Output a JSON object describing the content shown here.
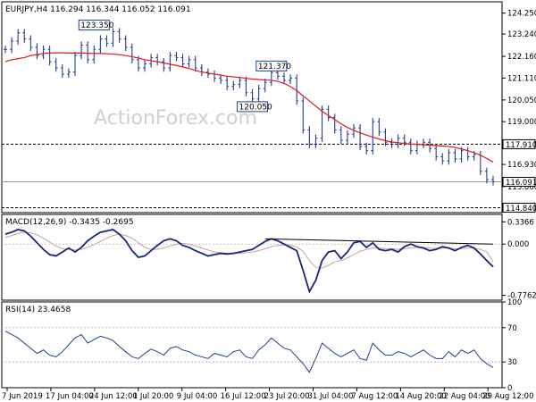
{
  "watermark": "ActionForex.com",
  "chart_data": [
    {
      "type": "candlestick",
      "title": "EURJPY,H4 116.294 116.344 116.052 116.091",
      "ylim": [
        114.6,
        124.8
      ],
      "y_ticks": [
        "124.250",
        "123.240",
        "122.160",
        "121.110",
        "120.050",
        "119.000",
        "117.910",
        "116.930",
        "115.860"
      ],
      "price_line": {
        "value": 116.091,
        "label": "116.091"
      },
      "levels": [
        {
          "value": 117.91,
          "label": "117.910",
          "style": "dashed"
        },
        {
          "value": 114.84,
          "label": "114.840",
          "style": "dashed"
        }
      ],
      "annotations": [
        {
          "text": "123.350",
          "x": 14,
          "y": 123.35
        },
        {
          "text": "121.370",
          "x": 42,
          "y": 121.37
        },
        {
          "text": "120.050",
          "x": 39,
          "y": 120.05
        }
      ],
      "close": [
        122.5,
        122.9,
        123.3,
        123.0,
        122.6,
        122.2,
        122.5,
        121.9,
        121.6,
        121.3,
        121.4,
        122.2,
        122.7,
        122.0,
        122.5,
        123.0,
        122.8,
        123.35,
        123.0,
        122.6,
        122.0,
        121.6,
        121.8,
        122.1,
        121.9,
        121.6,
        122.2,
        122.1,
        121.8,
        122.0,
        121.6,
        121.4,
        121.3,
        121.1,
        121.0,
        120.7,
        120.8,
        121.0,
        120.4,
        120.1,
        120.6,
        120.9,
        121.37,
        121.2,
        121.0,
        121.1,
        120.0,
        118.6,
        117.9,
        118.2,
        119.6,
        119.2,
        118.6,
        118.1,
        118.4,
        118.7,
        117.8,
        117.6,
        119.0,
        118.5,
        118.0,
        117.9,
        118.2,
        118.0,
        117.6,
        117.9,
        118.0,
        117.7,
        117.3,
        117.1,
        117.5,
        117.2,
        117.6,
        117.3,
        117.4,
        116.6,
        116.2,
        116.091
      ],
      "ma": [
        121.9,
        122.0,
        122.05,
        122.1,
        122.2,
        122.25,
        122.3,
        122.32,
        122.33,
        122.33,
        122.32,
        122.32,
        122.32,
        122.31,
        122.3,
        122.3,
        122.29,
        122.27,
        122.24,
        122.2,
        122.14,
        122.08,
        122.0,
        121.95,
        121.9,
        121.84,
        121.78,
        121.72,
        121.65,
        121.57,
        121.48,
        121.4,
        121.35,
        121.3,
        121.25,
        121.2,
        121.17,
        121.14,
        121.1,
        121.06,
        121.04,
        121.02,
        121.0,
        120.95,
        120.85,
        120.7,
        120.5,
        120.25,
        120.0,
        119.75,
        119.5,
        119.3,
        119.1,
        118.9,
        118.72,
        118.58,
        118.46,
        118.35,
        118.25,
        118.16,
        118.08,
        118.02,
        117.98,
        117.95,
        117.92,
        117.9,
        117.88,
        117.86,
        117.84,
        117.82,
        117.8,
        117.75,
        117.68,
        117.6,
        117.5,
        117.38,
        117.22,
        117.05
      ],
      "x_ticks": [
        "7 Jun 2019",
        "17 Jun 04:00",
        "24 Jun 12:00",
        "1 Jul 20:00",
        "9 Jul 04:00",
        "16 Jul 12:00",
        "23 Jul 20:00",
        "31 Jul 04:00",
        "7 Aug 12:00",
        "14 Aug 20:00",
        "22 Aug 04:00",
        "29 Aug 12:00"
      ]
    },
    {
      "type": "line",
      "title": "MACD(12,26,9) -0.3435 -0.2695",
      "ylim": [
        -0.85,
        0.45
      ],
      "y_ticks": [
        "0.3366",
        "0.000",
        "-0.7762"
      ],
      "series": [
        {
          "name": "MACD",
          "values": [
            0.15,
            0.18,
            0.22,
            0.2,
            0.12,
            0.02,
            -0.08,
            -0.16,
            -0.18,
            -0.12,
            -0.06,
            -0.12,
            -0.05,
            0.05,
            0.12,
            0.18,
            0.2,
            0.22,
            0.15,
            0.05,
            -0.1,
            -0.2,
            -0.18,
            -0.1,
            -0.02,
            0.05,
            0.08,
            0.05,
            -0.02,
            -0.05,
            -0.1,
            -0.14,
            -0.18,
            -0.16,
            -0.14,
            -0.15,
            -0.14,
            -0.12,
            -0.1,
            -0.08,
            -0.02,
            0.04,
            0.08,
            0.05,
            0.0,
            -0.05,
            -0.1,
            -0.4,
            -0.72,
            -0.55,
            -0.25,
            -0.12,
            -0.1,
            -0.22,
            -0.12,
            0.02,
            0.04,
            -0.05,
            0.02,
            -0.08,
            -0.1,
            -0.08,
            -0.12,
            -0.04,
            0.0,
            -0.04,
            -0.06,
            -0.1,
            -0.08,
            -0.04,
            -0.06,
            -0.1,
            -0.05,
            -0.02,
            -0.06,
            -0.15,
            -0.25,
            -0.3435
          ]
        },
        {
          "name": "Signal",
          "values": [
            0.1,
            0.13,
            0.16,
            0.18,
            0.17,
            0.14,
            0.09,
            0.03,
            -0.03,
            -0.07,
            -0.08,
            -0.09,
            -0.08,
            -0.05,
            -0.01,
            0.04,
            0.09,
            0.13,
            0.15,
            0.13,
            0.09,
            0.02,
            -0.05,
            -0.08,
            -0.08,
            -0.06,
            -0.03,
            0.0,
            0.01,
            0.0,
            -0.03,
            -0.06,
            -0.09,
            -0.12,
            -0.13,
            -0.14,
            -0.14,
            -0.14,
            -0.13,
            -0.12,
            -0.1,
            -0.07,
            -0.04,
            -0.02,
            -0.01,
            -0.02,
            -0.04,
            -0.11,
            -0.25,
            -0.35,
            -0.36,
            -0.32,
            -0.27,
            -0.25,
            -0.21,
            -0.16,
            -0.11,
            -0.08,
            -0.06,
            -0.06,
            -0.07,
            -0.07,
            -0.08,
            -0.07,
            -0.06,
            -0.05,
            -0.05,
            -0.06,
            -0.07,
            -0.06,
            -0.06,
            -0.07,
            -0.07,
            -0.06,
            -0.06,
            -0.08,
            -0.12,
            -0.2695
          ]
        }
      ]
    },
    {
      "type": "line",
      "title": "RSI(14) 23.4658",
      "ylim": [
        0,
        100
      ],
      "y_ticks": [
        "100",
        "70",
        "30",
        "0"
      ],
      "series": [
        {
          "name": "RSI",
          "values": [
            66,
            62,
            58,
            52,
            46,
            40,
            44,
            38,
            36,
            42,
            50,
            58,
            62,
            52,
            56,
            60,
            58,
            55,
            48,
            42,
            36,
            34,
            40,
            45,
            42,
            38,
            46,
            48,
            44,
            42,
            38,
            36,
            34,
            40,
            38,
            36,
            42,
            44,
            36,
            34,
            44,
            50,
            58,
            52,
            46,
            44,
            36,
            28,
            18,
            34,
            52,
            46,
            40,
            36,
            40,
            44,
            34,
            32,
            52,
            44,
            38,
            38,
            42,
            40,
            36,
            40,
            44,
            38,
            34,
            34,
            42,
            36,
            44,
            40,
            44,
            34,
            28,
            23.4658
          ]
        }
      ]
    }
  ]
}
